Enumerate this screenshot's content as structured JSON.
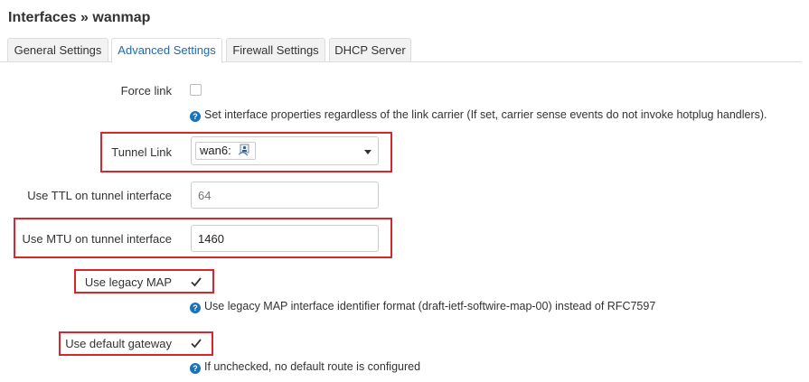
{
  "page": {
    "title": "Interfaces » wanmap"
  },
  "tabs": [
    {
      "label": "General Settings",
      "active": false
    },
    {
      "label": "Advanced Settings",
      "active": true
    },
    {
      "label": "Firewall Settings",
      "active": false
    },
    {
      "label": "DHCP Server",
      "active": false
    }
  ],
  "form": {
    "force_link": {
      "label": "Force link",
      "checked": false,
      "help": "Set interface properties regardless of the link carrier (If set, carrier sense events do not invoke hotplug handlers)."
    },
    "tunnel_link": {
      "label": "Tunnel Link",
      "value": "wan6:"
    },
    "ttl": {
      "label": "Use TTL on tunnel interface",
      "placeholder": "64"
    },
    "mtu": {
      "label": "Use MTU on tunnel interface",
      "value": "1460"
    },
    "legacy_map": {
      "label": "Use legacy MAP",
      "checked": true,
      "help": "Use legacy MAP interface identifier format (draft-ietf-softwire-map-00) instead of RFC7597"
    },
    "default_gateway": {
      "label": "Use default gateway",
      "checked": true,
      "help": "If unchecked, no default route is configured"
    }
  },
  "colors": {
    "highlight": "#d9262c",
    "link_blue": "#1a6bb0",
    "help_icon": "#1a73b8"
  },
  "icons": {
    "help": "question-circle-icon",
    "network": "network-interface-icon",
    "dropdown": "caret-down-icon",
    "check": "checkmark-icon"
  }
}
